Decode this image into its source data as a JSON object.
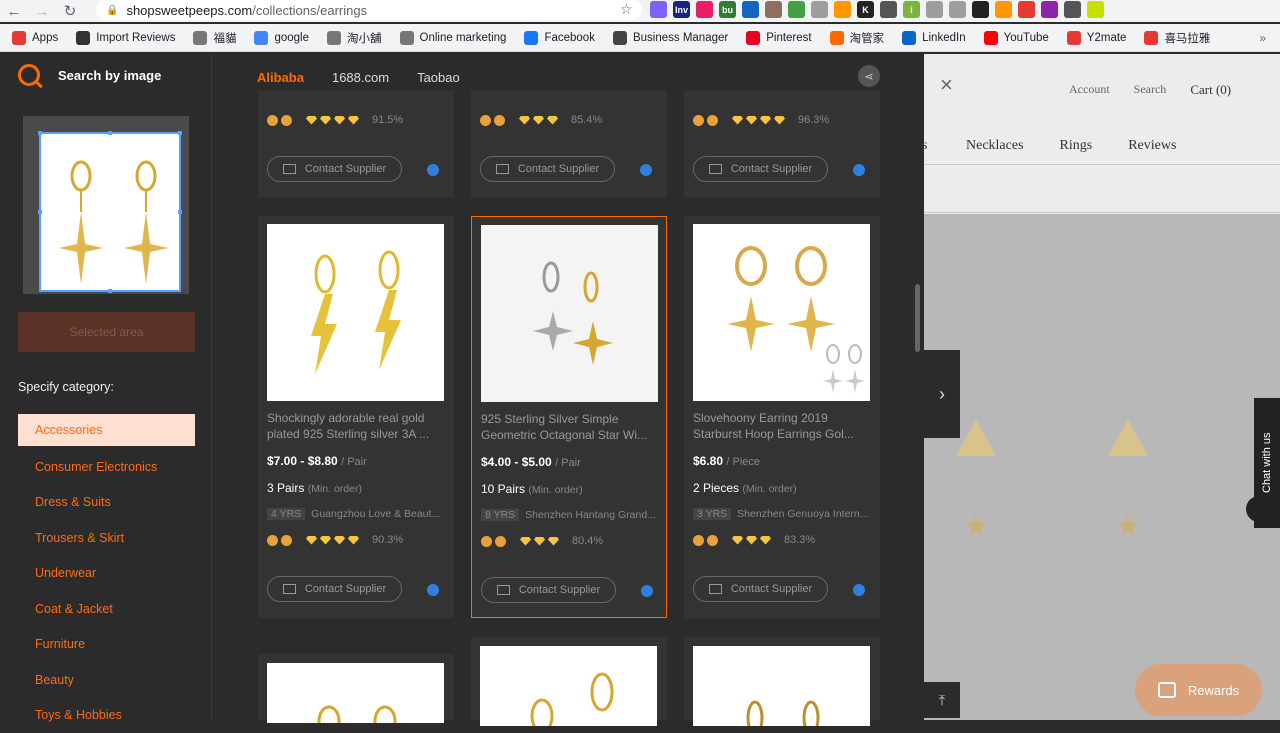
{
  "browser": {
    "url_host": "shopsweetpeeps.com",
    "url_path": "/collections/earrings",
    "bookmarks": [
      {
        "label": "Apps",
        "color": "#e53935"
      },
      {
        "label": "Import Reviews",
        "color": "#333333"
      },
      {
        "label": "福貓",
        "color": "#777777"
      },
      {
        "label": "google",
        "color": "#4285f4"
      },
      {
        "label": "淘小舖",
        "color": "#777777"
      },
      {
        "label": "Online marketing",
        "color": "#777777"
      },
      {
        "label": "Facebook",
        "color": "#1877f2"
      },
      {
        "label": "Business Manager",
        "color": "#444444"
      },
      {
        "label": "Pinterest",
        "color": "#e60023"
      },
      {
        "label": "淘管家",
        "color": "#ff6a00"
      },
      {
        "label": "LinkedIn",
        "color": "#0a66c2"
      },
      {
        "label": "YouTube",
        "color": "#ff0000"
      },
      {
        "label": "Y2mate",
        "color": "#e53935"
      },
      {
        "label": "喜马拉雅",
        "color": "#e53935"
      }
    ],
    "extensions": [
      {
        "label": "",
        "color": "#7b61ff"
      },
      {
        "label": "Inv",
        "color": "#1a237e"
      },
      {
        "label": "",
        "color": "#e91e63"
      },
      {
        "label": "bu",
        "color": "#2e7d32"
      },
      {
        "label": "",
        "color": "#1565c0"
      },
      {
        "label": "",
        "color": "#8d6e63"
      },
      {
        "label": "",
        "color": "#43a047"
      },
      {
        "label": "",
        "color": "#9e9e9e"
      },
      {
        "label": "",
        "color": "#ff9800"
      },
      {
        "label": "K",
        "color": "#222222"
      },
      {
        "label": "",
        "color": "#555555"
      },
      {
        "label": "i",
        "color": "#7cb342"
      },
      {
        "label": "",
        "color": "#9e9e9e"
      },
      {
        "label": "",
        "color": "#9e9e9e"
      },
      {
        "label": "",
        "color": "#222222"
      },
      {
        "label": "",
        "color": "#ff9800"
      },
      {
        "label": "",
        "color": "#e53935"
      },
      {
        "label": "",
        "color": "#8e24aa"
      },
      {
        "label": "",
        "color": "#555555"
      },
      {
        "label": "",
        "color": "#c6e000"
      }
    ]
  },
  "panel": {
    "search_title": "Search by image",
    "selected_area_label": "Selected area",
    "category_label": "Specify category:",
    "categories": [
      {
        "label": "Accessories",
        "active": true
      },
      {
        "label": "Consumer Electronics"
      },
      {
        "label": "Dress & Suits"
      },
      {
        "label": "Trousers & Skirt"
      },
      {
        "label": "Underwear"
      },
      {
        "label": "Coat & Jacket"
      },
      {
        "label": "Furniture"
      },
      {
        "label": "Beauty"
      },
      {
        "label": "Toys & Hobbies"
      }
    ],
    "tabs": [
      "Alibaba",
      "1688.com",
      "Taobao"
    ],
    "top_row": [
      {
        "rate": "91.5%",
        "contact": "Contact Supplier"
      },
      {
        "rate": "85.4%",
        "contact": "Contact Supplier"
      },
      {
        "rate": "96.3%",
        "contact": "Contact Supplier"
      }
    ],
    "products": [
      {
        "title": "Shockingly adorable real gold plated 925 Sterling silver 3A ...",
        "price": "$7.00 - $8.80",
        "unit": "/ Pair",
        "moq": "3 Pairs",
        "moq_note": "(Min. order)",
        "years": "4",
        "yrs_label": "YRS",
        "supplier": "Guangzhou Love & Beaut...",
        "rate": "90.3%",
        "contact": "Contact Supplier"
      },
      {
        "title": "925 Sterling Silver Simple Geometric Octagonal Star Wi...",
        "price": "$4.00 - $5.00",
        "unit": "/ Pair",
        "moq": "10 Pairs",
        "moq_note": "(Min. order)",
        "years": "8",
        "yrs_label": "YRS",
        "supplier": "Shenzhen Hantang Grand...",
        "rate": "80.4%",
        "contact": "Contact Supplier"
      },
      {
        "title": "Slovehoony Earring 2019 Starburst Hoop Earrings Gol...",
        "price": "$6.80",
        "unit": "/ Piece",
        "moq": "2 Pieces",
        "moq_note": "(Min. order)",
        "years": "3",
        "yrs_label": "YRS",
        "supplier": "Shenzhen Genuoya Intern...",
        "rate": "83.3%",
        "contact": "Contact Supplier"
      }
    ]
  },
  "shop": {
    "account": "Account",
    "search": "Search",
    "cart": "Cart (0)",
    "nav_partial": "s",
    "nav": [
      "Necklaces",
      "Rings",
      "Reviews"
    ],
    "chat": "Chat with us",
    "rewards": "Rewards"
  }
}
